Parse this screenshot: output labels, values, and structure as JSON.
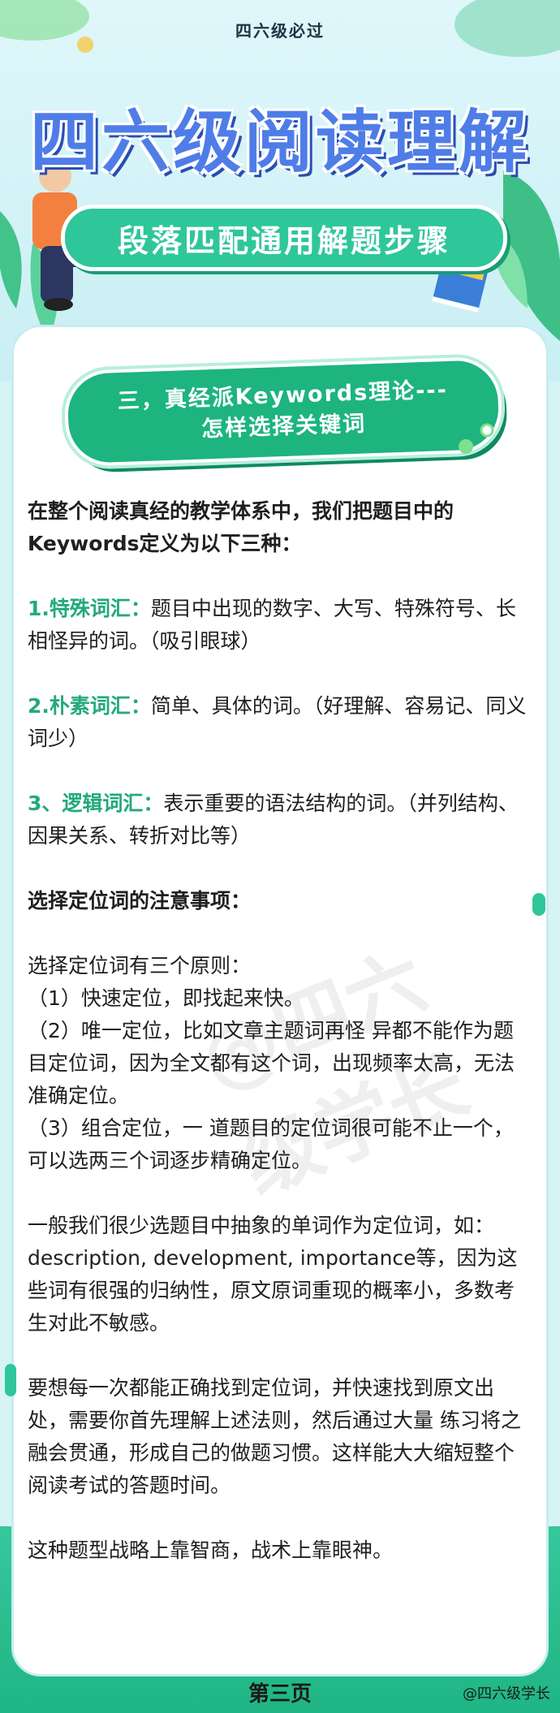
{
  "header": {
    "tag": "四六级必过",
    "title": "四六级阅读理解",
    "subtitle": "段落匹配通用解题步骤"
  },
  "section": {
    "line1": "三，真经派Keywords理论---",
    "line2": "怎样选择关键词"
  },
  "content": {
    "intro": "在整个阅读真经的教学体系中，我们把题目中的Keywords定义为以下三种：",
    "items": [
      {
        "label": "1.特殊词汇：",
        "text": "题目中出现的数字、大写、特殊符号、长相怪异的词。（吸引眼球）"
      },
      {
        "label": "2.朴素词汇：",
        "text": "简单、具体的词。（好理解、容易记、同义词少）"
      },
      {
        "label": "3、逻辑词汇：",
        "text": "表示重要的语法结构的词。（并列结构、因果关系、转折对比等）"
      }
    ],
    "notes_heading": "选择定位词的注意事项：",
    "principles_intro": "选择定位词有三个原则：",
    "principles": [
      "（1）快速定位，即找起来快。",
      "（2）唯一定位，比如文章主题词再怪 异都不能作为题目定位词，因为全文都有这个词，出现频率太高，无法准确定位。",
      "（3）组合定位，一 道题目的定位词很可能不止一个，可以选两三个词逐步精确定位。"
    ],
    "para_abstract": "一般我们很少选题目中抽象的单词作为定位词，如：description, development, importance等，因为这 些词有很强的归纳性，原文原词重现的概率小，多数考生对此不敏感。",
    "para_practice": "要想每一次都能正确找到定位词，并快速找到原文出处，需要你首先理解上述法则，然后通过大量 练习将之融会贯通，形成自己的做题习惯。这样能大大缩短整个阅读考试的答题时间。",
    "para_final": "这种题型战略上靠智商，战术上靠眼神。"
  },
  "footer": {
    "page": "第三页",
    "watermark": "@四六级学长"
  },
  "colors": {
    "accent_green": "#23a97e",
    "title_blue": "#4f7de8",
    "banner_green": "#1db47f"
  }
}
